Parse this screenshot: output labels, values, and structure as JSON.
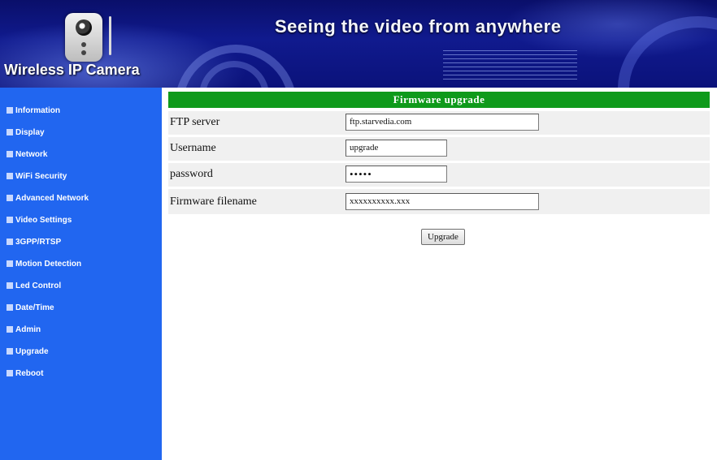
{
  "banner": {
    "headline": "Seeing the video from anywhere",
    "brand": "Wireless IP Camera"
  },
  "sidebar": {
    "items": [
      {
        "label": "Information"
      },
      {
        "label": "Display"
      },
      {
        "label": "Network"
      },
      {
        "label": "WiFi Security"
      },
      {
        "label": "Advanced Network"
      },
      {
        "label": "Video Settings"
      },
      {
        "label": "3GPP/RTSP"
      },
      {
        "label": "Motion Detection"
      },
      {
        "label": "Led Control"
      },
      {
        "label": "Date/Time"
      },
      {
        "label": "Admin"
      },
      {
        "label": "Upgrade"
      },
      {
        "label": "Reboot"
      }
    ]
  },
  "form": {
    "title": "Firmware upgrade",
    "fields": [
      {
        "label": "FTP server",
        "value": "ftp.starvedia.com"
      },
      {
        "label": "Username",
        "value": "upgrade"
      },
      {
        "label": "password",
        "value": "•••••"
      },
      {
        "label": "Firmware filename",
        "value": "xxxxxxxxxx.xxx"
      }
    ],
    "submit_label": "Upgrade"
  },
  "colors": {
    "sidebar_bg": "#2166f0",
    "title_bar_bg": "#0f9a1b",
    "banner_bg": "#101a8e"
  }
}
